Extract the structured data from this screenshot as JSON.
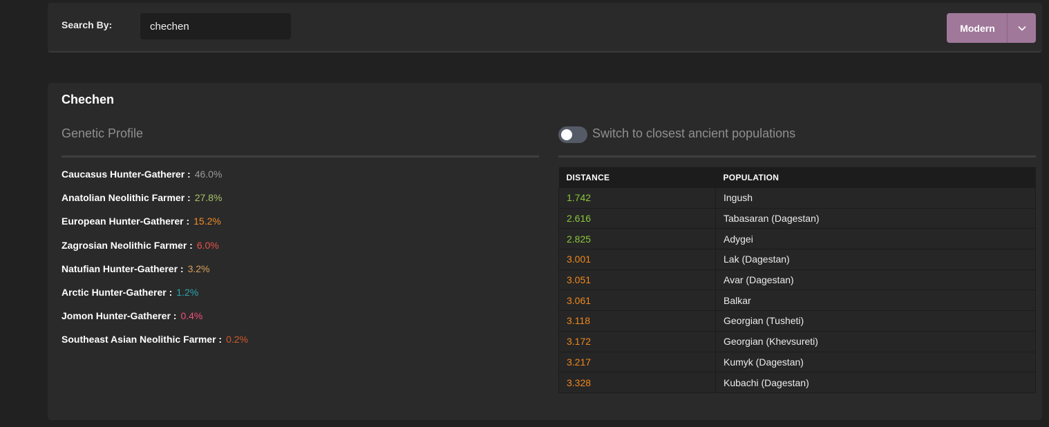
{
  "search": {
    "label": "Search By:",
    "value": "chechen"
  },
  "mode": {
    "selected": "Modern"
  },
  "population": {
    "title": "Chechen"
  },
  "genetic_profile": {
    "heading": "Genetic Profile",
    "items": [
      {
        "name": "Caucasus Hunter-Gatherer :",
        "value": "46.0%",
        "color": "#9a9a9a"
      },
      {
        "name": "Anatolian Neolithic Farmer :",
        "value": "27.8%",
        "color": "#a8c46a"
      },
      {
        "name": "European Hunter-Gatherer :",
        "value": "15.2%",
        "color": "#f08c2a"
      },
      {
        "name": "Zagrosian Neolithic Farmer :",
        "value": "6.0%",
        "color": "#e8524a"
      },
      {
        "name": "Natufian Hunter-Gatherer :",
        "value": "3.2%",
        "color": "#d9a25a"
      },
      {
        "name": "Arctic Hunter-Gatherer :",
        "value": "1.2%",
        "color": "#2aa6b0"
      },
      {
        "name": "Jomon Hunter-Gatherer :",
        "value": "0.4%",
        "color": "#f0507a"
      },
      {
        "name": "Southeast Asian Neolithic Farmer :",
        "value": "0.2%",
        "color": "#d05a2e"
      }
    ]
  },
  "ancient_toggle": {
    "label": "Switch to closest ancient populations",
    "on": false
  },
  "distance_table": {
    "headers": [
      "DISTANCE",
      "POPULATION"
    ],
    "rows": [
      {
        "distance": "1.742",
        "population": "Ingush",
        "color": "#8cc83c"
      },
      {
        "distance": "2.616",
        "population": "Tabasaran (Dagestan)",
        "color": "#8cc83c"
      },
      {
        "distance": "2.825",
        "population": "Adygei",
        "color": "#8cc83c"
      },
      {
        "distance": "3.001",
        "population": "Lak (Dagestan)",
        "color": "#f0891e"
      },
      {
        "distance": "3.051",
        "population": "Avar (Dagestan)",
        "color": "#f0891e"
      },
      {
        "distance": "3.061",
        "population": "Balkar",
        "color": "#f0891e"
      },
      {
        "distance": "3.118",
        "population": "Georgian (Tusheti)",
        "color": "#f0891e"
      },
      {
        "distance": "3.172",
        "population": "Georgian (Khevsureti)",
        "color": "#f0891e"
      },
      {
        "distance": "3.217",
        "population": "Kumyk (Dagestan)",
        "color": "#f0891e"
      },
      {
        "distance": "3.328",
        "population": "Kubachi (Dagestan)",
        "color": "#f0891e"
      }
    ]
  }
}
